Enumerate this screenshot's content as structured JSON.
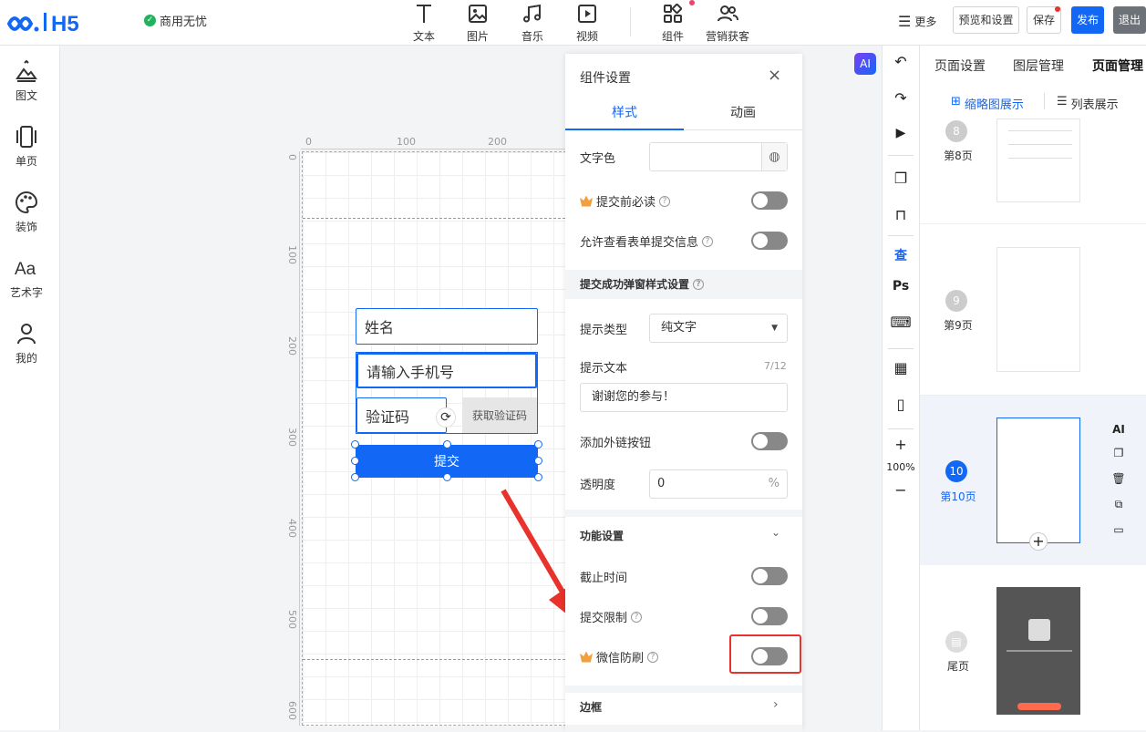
{
  "header": {
    "badge": "商用无忧",
    "tools": [
      {
        "label": "文本",
        "icon": "text-icon"
      },
      {
        "label": "图片",
        "icon": "image-icon"
      },
      {
        "label": "音乐",
        "icon": "music-icon"
      },
      {
        "label": "视频",
        "icon": "video-icon"
      },
      {
        "label": "组件",
        "icon": "components-icon"
      },
      {
        "label": "营销获客",
        "icon": "users-icon"
      }
    ],
    "more": "更多",
    "preview": "预览和设置",
    "save": "保存",
    "publish": "发布",
    "exit": "退出"
  },
  "sidebar": {
    "items": [
      {
        "label": "图文",
        "icon": "image-text-icon"
      },
      {
        "label": "单页",
        "icon": "single-page-icon"
      },
      {
        "label": "装饰",
        "icon": "palette-icon"
      },
      {
        "label": "艺术字",
        "icon": "art-text-icon"
      },
      {
        "label": "我的",
        "icon": "user-icon"
      }
    ]
  },
  "ruler": {
    "h": [
      "0",
      "100",
      "200"
    ],
    "v": [
      "0",
      "100",
      "200",
      "300",
      "400",
      "500",
      "600"
    ]
  },
  "form": {
    "name_placeholder": "姓名",
    "phone_placeholder": "请输入手机号",
    "code_placeholder": "验证码",
    "get_code": "获取验证码",
    "submit": "提交"
  },
  "settings": {
    "title": "组件设置",
    "tab_style": "样式",
    "tab_anim": "动画",
    "text_color": "文字色",
    "must_read": "提交前必读",
    "allow_view": "允许查看表单提交信息",
    "popup_section": "提交成功弹窗样式设置",
    "tip_type": "提示类型",
    "tip_type_value": "纯文字",
    "tip_text": "提示文本",
    "tip_count": "7/12",
    "tip_value": "谢谢您的参与！",
    "ext_link": "添加外链按钮",
    "opacity": "透明度",
    "opacity_value": "0",
    "opacity_unit": "%",
    "func_section": "功能设置",
    "deadline": "截止时间",
    "submit_limit": "提交限制",
    "wechat_guard": "微信防刷",
    "border": "边框"
  },
  "right_toolbar": {
    "zoom": "100%",
    "ps": "Ps",
    "check": "查"
  },
  "ai_badge": "AI",
  "pages_panel": {
    "tabs": [
      "页面设置",
      "图层管理",
      "页面管理"
    ],
    "view_thumb": "缩略图展示",
    "view_list": "列表展示",
    "pages": [
      {
        "num": "8",
        "label": "第8页"
      },
      {
        "num": "9",
        "label": "第9页"
      },
      {
        "num": "10",
        "label": "第10页"
      },
      {
        "num": "",
        "label": "尾页"
      }
    ],
    "side_actions": [
      "AI"
    ]
  },
  "colors": {
    "accent": "#1267f5",
    "red": "#e8322b",
    "toggle_off": "#888888"
  }
}
